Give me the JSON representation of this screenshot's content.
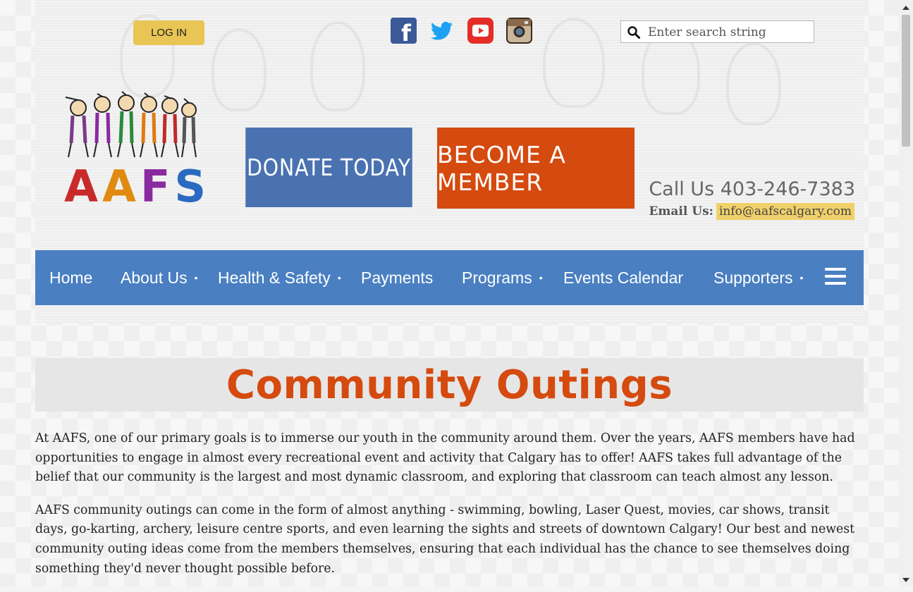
{
  "header": {
    "login_label": "LOG IN",
    "search_placeholder": "Enter search string",
    "social": [
      "facebook-icon",
      "twitter-icon",
      "youtube-icon",
      "instagram-icon"
    ],
    "logo_text": "AAFS",
    "donate_label": "DONATE TODAY",
    "member_label": "BECOME A MEMBER",
    "call_text": "Call Us 403-246-7383",
    "email_label": "Email Us:",
    "email_value": "info@aafscalgary.com"
  },
  "nav": {
    "items": [
      {
        "label": "Home"
      },
      {
        "label": "About Us",
        "dot": "•"
      },
      {
        "label": "Health & Safety",
        "dot": "•"
      },
      {
        "label": "Payments"
      },
      {
        "label": "Programs",
        "dot": "•"
      },
      {
        "label": "Events Calendar"
      },
      {
        "label": "Supporters",
        "dot": "•"
      }
    ]
  },
  "main": {
    "title": "Community Outings",
    "paragraphs": [
      "At AAFS, one of our primary goals is to immerse our youth in the community around them. Over the years, AAFS members have had opportunities to engage in almost every recreational event and activity that Calgary has to offer! AAFS takes full advantage of the belief that our community is the largest and most dynamic classroom, and exploring that classroom can teach almost any lesson.",
      "AAFS community outings can come in the form of almost anything - swimming, bowling, Laser Quest, movies, car shows, transit days, go-karting, archery, leisure centre sports, and even learning the sights and streets of downtown Calgary! Our best and newest community outing ideas come from the members themselves, ensuring that each individual has the chance to see themselves doing something they'd never thought possible before."
    ]
  },
  "colors": {
    "accent_orange": "#d54a0e",
    "nav_blue": "#4a7fc2",
    "donate_blue": "#4a72b1",
    "login_yellow": "#e8c555"
  }
}
